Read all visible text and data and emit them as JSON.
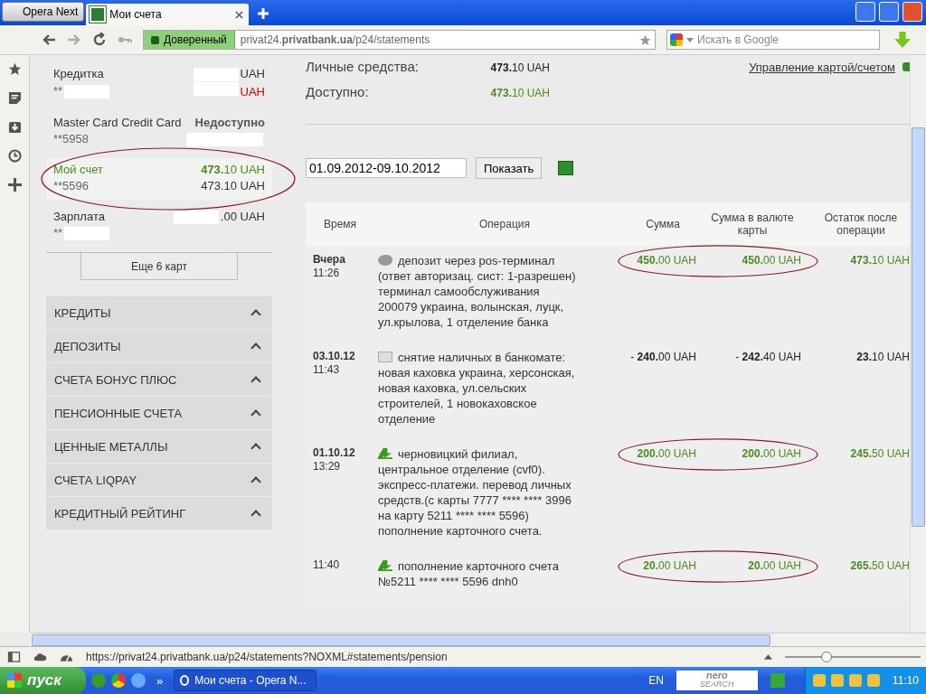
{
  "browser": {
    "menu_button": "Opera Next",
    "tabs": [
      {
        "title": "Мои счета",
        "selected": true
      }
    ],
    "security_badge": "Доверенный",
    "url": "privat24.**privatbank.ua**/p24/statements",
    "search_placeholder": "Искать в Google"
  },
  "cards": [
    {
      "name": "Кредитка",
      "number": "**",
      "balance": "UAH",
      "available": "UAH",
      "balance_masked": true,
      "number_masked": true,
      "available_masked": true,
      "negative": true,
      "selected": false,
      "circled": false
    },
    {
      "name": "Master Card Credit Card",
      "number": "**5958",
      "balance": "Недоступно",
      "balance_masked": false,
      "number_masked": false,
      "available_masked": true,
      "unavailable": true,
      "selected": false,
      "circled": false
    },
    {
      "name": "Мой счет",
      "number": "**5596",
      "balance": "**473.**10 UAH",
      "available": "473.10 UAH",
      "balance_masked": false,
      "number_masked": false,
      "available_masked": false,
      "negative": false,
      "selected": true,
      "circled": true
    },
    {
      "name": "Зарплата",
      "number": "**",
      "balance": ".00 UAH",
      "balance_masked": true,
      "number_masked": true,
      "available_masked": false,
      "selected": false,
      "circled": false
    }
  ],
  "more_button": "Еще 6 карт",
  "sections": [
    "КРЕДИТЫ",
    "ДЕПОЗИТЫ",
    "СЧЕТА БОНУС ПЛЮС",
    "ПЕНСИОННЫЕ СЧЕТА",
    "ЦЕННЫЕ МЕТАЛЛЫ",
    "СЧЕТА LIQPAY",
    "КРЕДИТНЫЙ РЕЙТИНГ"
  ],
  "summary": {
    "own_funds_label": "Личные средства:",
    "own_funds": "**473.**10 UAH",
    "available_label": "Доступно:",
    "available": "**473.**10 UAH",
    "manage_link": "Управление картой/счетом"
  },
  "filter": {
    "period": "01.09.2012-09.10.2012",
    "show_button": "Показать"
  },
  "table": {
    "columns": [
      "Время",
      "Операция",
      "Сумма",
      "Сумма в валюте карты",
      "Остаток после операции"
    ],
    "rows": [
      {
        "date": "Вчера",
        "time": "11:26",
        "kind": "deposit",
        "description": "депозит через pos-терминал (ответ авторизац. сист: 1-разрешен) терминал самообслуживания 200079 украина, волынская, луцк, ул.крылова, 1 отделение банка",
        "amount": "**450.**00 UAH",
        "card_amount": "**450.**00 UAH",
        "balance": "**473.**10 UAH",
        "circled": true
      },
      {
        "date": "03.10.12",
        "time": "11:43",
        "kind": "withdrawal",
        "description": "снятие наличных в банкомате: новая каховка украина, херсонская, новая каховка, ул.сельских строителей, 1 новокаховское отделение",
        "amount": "- **240.**00 UAH",
        "card_amount": "- **242.**40 UAH",
        "balance": "**23.**10 UAH",
        "circled": false
      },
      {
        "date": "01.10.12",
        "time": "13:29",
        "kind": "transfer",
        "description": "черновицкий филиал, центральное отделение (cvf0). экспресс-платежи. перевод личных средств.(с карты 7777 **** **** 3996 на карту 5211 **** **** 5596) пополнение карточного счета.",
        "amount": "**200.**00 UAH",
        "card_amount": "**200.**00 UAH",
        "balance": "**245.**50 UAH",
        "circled": true
      },
      {
        "time": "11:40",
        "kind": "transfer",
        "description": "пополнение карточного счета №5211 **** **** 5596 dnh0",
        "amount": "**20.**00 UAH",
        "card_amount": "**20.**00 UAH",
        "balance": "**265.**50 UAH",
        "circled": true
      }
    ]
  },
  "status_bar": {
    "url": "https://privat24.privatbank.ua/p24/statements?NOXML#statements/pension",
    "zoom": {
      "level": 0.3
    }
  },
  "taskbar": {
    "start": "пуск",
    "more": "»",
    "windows": [
      {
        "title": "Мои счета - Opera N...",
        "selected": true
      }
    ],
    "language": "EN",
    "nero_logo": "nero",
    "nero_search": "SEARCH",
    "clock": "11:10"
  }
}
